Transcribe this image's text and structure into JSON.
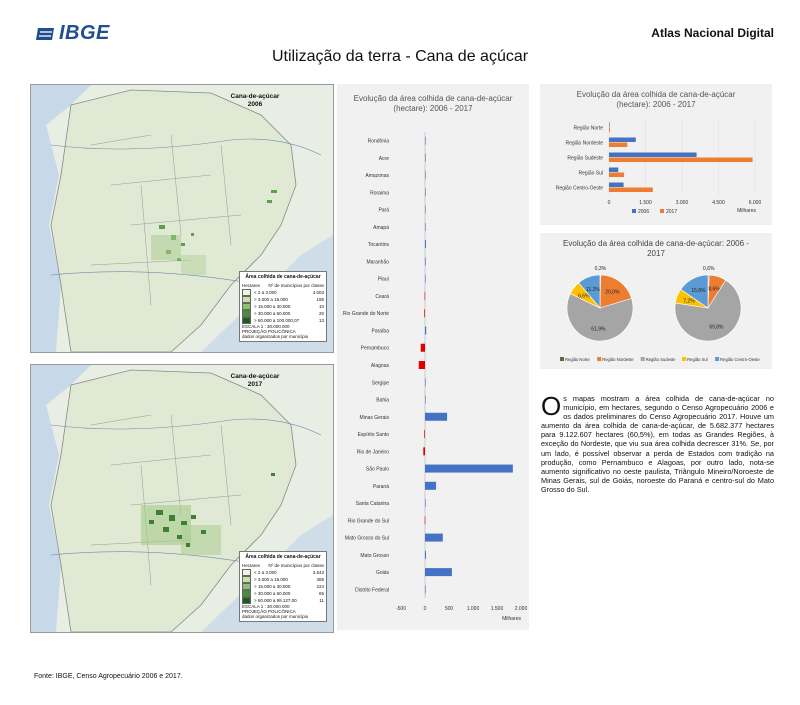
{
  "header": {
    "logo_text": "IBGE",
    "atlas_label": "Atlas Nacional Digital",
    "title": "Utilização da terra - Cana de açúcar"
  },
  "maps": [
    {
      "title_line1": "Cana-de-açúcar",
      "title_line2": "2006",
      "legend_title": "Área colhida de cana-de-açúcar",
      "legend_col1": "Hectares",
      "legend_col2": "Nº de municípios por classe",
      "legend_rows": [
        {
          "label": "< 2 a 3.000",
          "value": "4.003",
          "color": "#f1f5e4"
        },
        {
          "label": "> 3.000 a 15.000",
          "value": "195",
          "color": "#c9e0a8"
        },
        {
          "label": "> 15.000 a 30.000",
          "value": "10",
          "color": "#8fc06a"
        },
        {
          "label": "> 30.000 a 60.000",
          "value": "20",
          "color": "#4a8d3a"
        },
        {
          "label": "> 60.000 a 100.000,07",
          "value": "13",
          "color": "#1f5a1f"
        }
      ],
      "legend_scale": "ESCALA 1 : 30.000.000",
      "legend_projection": "PROJEÇÃO POLICÔNICA",
      "legend_note": "dados organizados por município"
    },
    {
      "title_line1": "Cana-de-açúcar",
      "title_line2": "2017",
      "legend_title": "Área colhida de cana-de-açúcar",
      "legend_col1": "Hectares",
      "legend_col2": "Nº de municípios por classe",
      "legend_rows": [
        {
          "label": "< 2 a 3.000",
          "value": "3.543",
          "color": "#f1f5e4"
        },
        {
          "label": "> 3.000 a 15.000",
          "value": "369",
          "color": "#c9e0a8"
        },
        {
          "label": "> 15.000 a 30.000",
          "value": "224",
          "color": "#8fc06a"
        },
        {
          "label": "> 30.000 a 60.000",
          "value": "65",
          "color": "#4a8d3a"
        },
        {
          "label": "> 60.000 a 99.127,00",
          "value": "11",
          "color": "#1f5a1f"
        }
      ],
      "legend_scale": "ESCALA 1 : 30.000.000",
      "legend_projection": "PROJEÇÃO POLICÔNICA",
      "legend_note": "dados organizados por município"
    }
  ],
  "body_text": {
    "dropcap": "O",
    "text": "s mapas mostram a área colhida de cana-de-açúcar no município, em hectares, segundo o Censo Agropecuário 2006 e os dados preliminares do Censo Agropecuário 2017. Houve um aumento da área colhida de cana-de-açúcar, de 5.682.377 hectares para 9.122.607 hectares (60,5%), em todas as Grandes Regiões, à exceção do Nordeste, que viu sua área colhida decrescer 31%. Se, por um lado, é possível observar a perda de Estados com tradição na produção, como Pernambuco e Alagoas, por outro lado, nota-se aumento significativo no oeste paulista, Triângulo Mineiro/Noroeste de Minas Gerais, sul de Goiás, noroeste do Paraná e centro-sul do Mato Grosso do Sul."
  },
  "source": "Fonte: IBGE, Censo Agropecuário 2006 e 2017.",
  "chart_data": [
    {
      "type": "bar",
      "orientation": "horizontal",
      "title": "Evolução da área colhida de cana-de-açúcar (hectare): 2006 - 2017",
      "xlabel": "Milhares",
      "xlim": [
        -500,
        2000
      ],
      "xticks": [
        "-500",
        "0",
        "500",
        "1.000",
        "1.500",
        "2.000"
      ],
      "categories": [
        "Rondônia",
        "Acre",
        "Amazonas",
        "Roraima",
        "Pará",
        "Amapá",
        "Tocantins",
        "Maranhão",
        "Piauí",
        "Ceará",
        "Rio Grande do Norte",
        "Paraíba",
        "Pernambuco",
        "Alagoas",
        "Sergipe",
        "Bahia",
        "Minas Gerais",
        "Espírito Santo",
        "Rio de Janeiro",
        "São Paulo",
        "Paraná",
        "Santa Catarina",
        "Rio Grande do Sul",
        "Mato Grosso do Sul",
        "Mato Grosso",
        "Goiás",
        "Distrito Federal"
      ],
      "values": [
        1,
        0,
        3,
        1,
        5,
        0,
        20,
        15,
        5,
        -8,
        -15,
        25,
        -90,
        -130,
        10,
        5,
        460,
        -15,
        -35,
        1830,
        230,
        0,
        -5,
        370,
        20,
        560,
        0
      ],
      "positive_color": "#4472c4",
      "negative_color": "#e00000"
    },
    {
      "type": "bar",
      "orientation": "horizontal",
      "title": "Evolução da área colhida de cana-de-açúcar (hectare): 2006 - 2017",
      "xlabel": "Milhares",
      "xlim": [
        0,
        6000
      ],
      "xticks": [
        "0",
        "1.500",
        "3.000",
        "4.500",
        "6.000"
      ],
      "categories": [
        "Região Norte",
        "Região Nordeste",
        "Região Sudeste",
        "Região Sul",
        "Região Centro-Oeste"
      ],
      "series": [
        {
          "name": "2006",
          "color": "#4472c4",
          "values": [
            20,
            1100,
            3600,
            380,
            600
          ]
        },
        {
          "name": "2017",
          "color": "#ed7d31",
          "values": [
            40,
            750,
            5900,
            620,
            1800
          ]
        }
      ]
    },
    {
      "type": "pie",
      "title": "Evolução da área colhida de cana-de-açúcar: 2006 - 2017",
      "labels": [
        "Região Norte",
        "Região Nordeste",
        "Região Sudeste",
        "Região Sul",
        "Região Centro-Oeste"
      ],
      "colors": [
        "#5a6b4a",
        "#ed7d31",
        "#a5a5a5",
        "#ffc000",
        "#5b9bd5"
      ],
      "pies": [
        {
          "name": "2006",
          "values": [
            0.3,
            20.0,
            61.9,
            6.6,
            11.2
          ],
          "labels": [
            "0,3%",
            "20,0%",
            "61,9%",
            "6,6%",
            "11,2%"
          ]
        },
        {
          "name": "2017",
          "values": [
            0.6,
            8.6,
            69.8,
            7.2,
            15.8
          ],
          "labels": [
            "0,6%",
            "8,6%",
            "69,8%",
            "7,2%",
            "15,8%"
          ]
        }
      ]
    }
  ]
}
